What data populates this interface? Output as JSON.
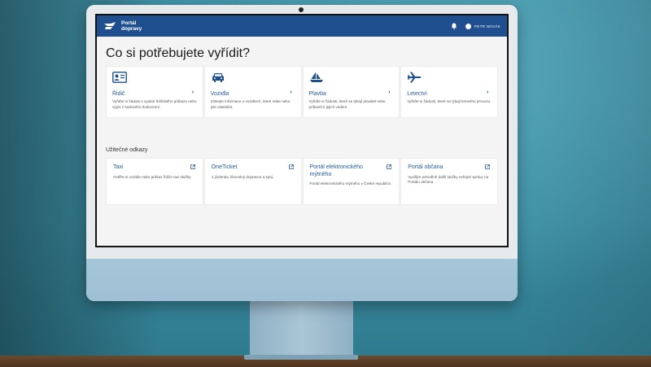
{
  "header": {
    "logo_text": "Portál\ndopravy",
    "user_name": "PETR NOVÁK"
  },
  "main": {
    "title": "Co si potřebujete vyřídit?",
    "cards": [
      {
        "icon": "id-card-icon",
        "title": "Řidič",
        "desc": "Vyřiďte si žádost o vydání řidičského průkazu nebo výpis z bodového hodnocení."
      },
      {
        "icon": "car-icon",
        "title": "Vozidla",
        "desc": "Získejte informace o vozidlech, které máte nebo jste vlastnil/a."
      },
      {
        "icon": "sailboat-icon",
        "title": "Plavba",
        "desc": "Vyřiďte si žádosti, které se týkají plavidel nebo průkazů k jejich vedení."
      },
      {
        "icon": "airplane-icon",
        "title": "Letectví",
        "desc": "Vyřiďte si žádosti, které se týkají letového provozu."
      }
    ]
  },
  "links_section": {
    "title": "Užitečné odkazy",
    "links": [
      {
        "title": "Taxi",
        "desc": "Ověřte si vozidlo nebo průkaz řidiče taxi služby"
      },
      {
        "title": "OneTicket",
        "desc": "1 jízdenka, libovolný dopravce a spoj."
      },
      {
        "title": "Portál elektronického mýtného",
        "desc": "Portál elektronického mýtného v České republice."
      },
      {
        "title": "Portál občana",
        "desc": "Využijte pohodlně další služby veřejné správy na Portálu občana."
      }
    ]
  },
  "colors": {
    "brand": "#1f4f8f",
    "link": "#1f5a9e"
  }
}
